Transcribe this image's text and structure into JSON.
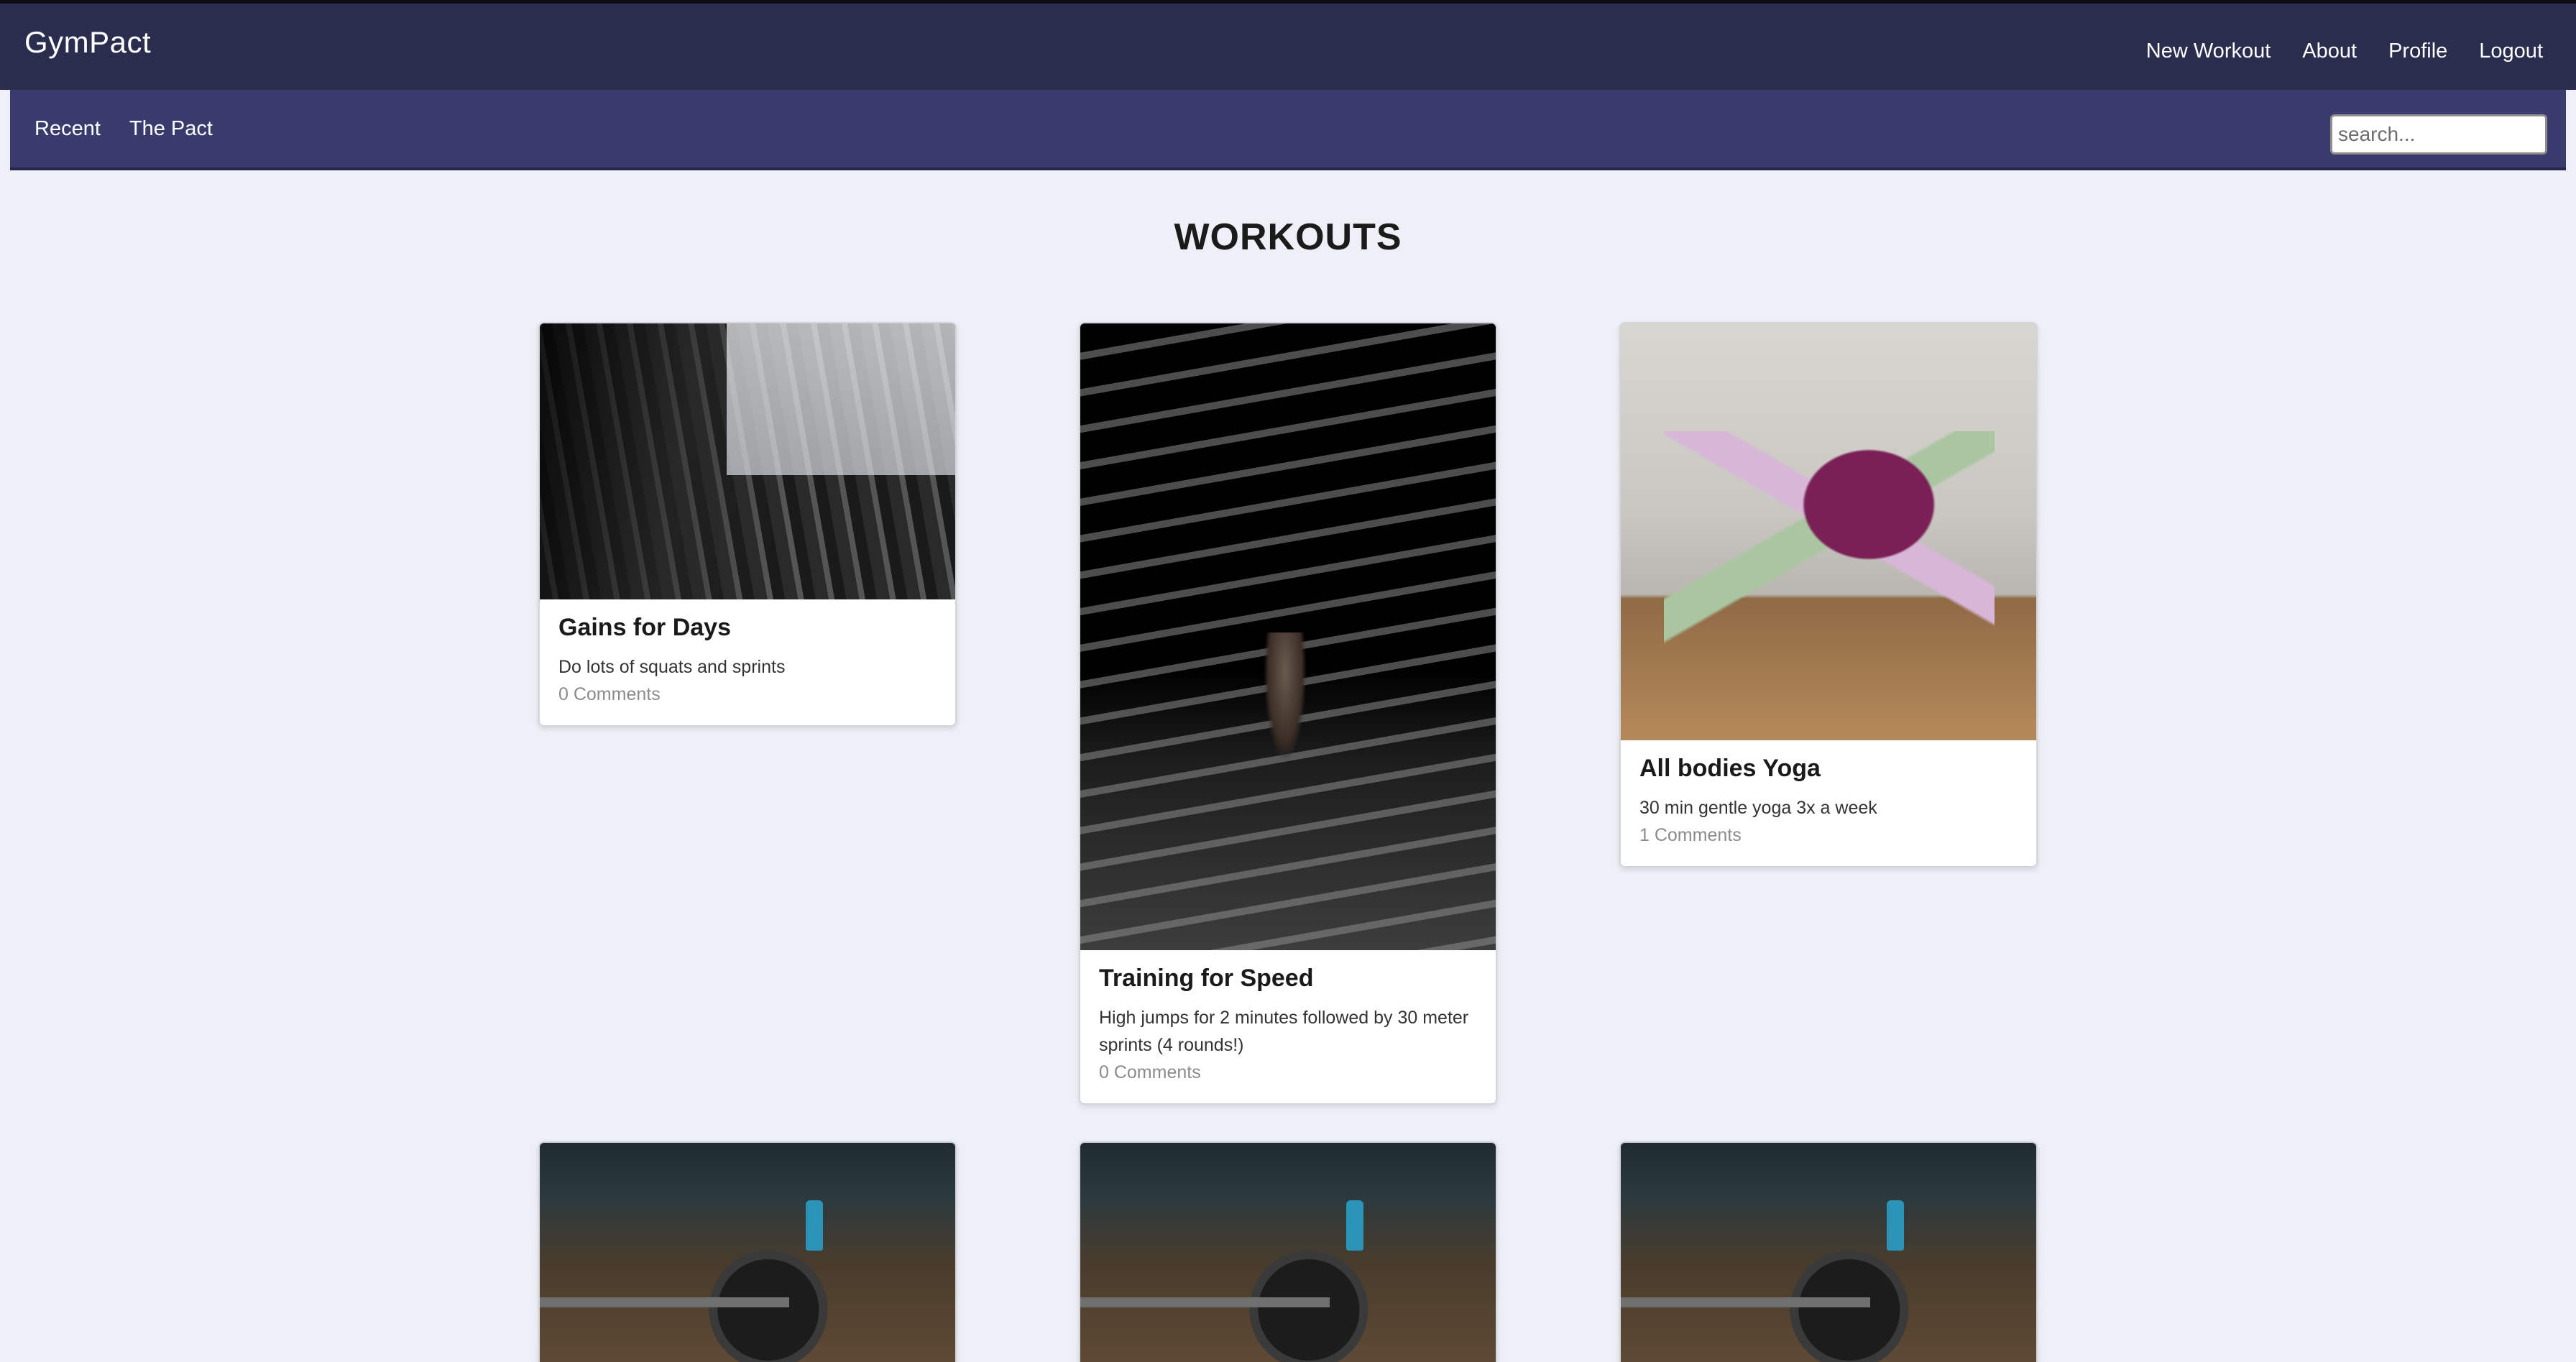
{
  "header": {
    "brand": "GymPact",
    "nav": [
      "New Workout",
      "About",
      "Profile",
      "Logout"
    ]
  },
  "subnav": {
    "links": [
      "Recent",
      "The Pact"
    ],
    "search_placeholder": "search..."
  },
  "main": {
    "title": "WORKOUTS",
    "cards": [
      {
        "title": "Gains for Days",
        "description": "Do lots of squats and sprints",
        "comments": "0 Comments",
        "image": "gym-dumbbell-rack-photo"
      },
      {
        "title": "Training for Speed",
        "description": "High jumps for 2 minutes followed by 30 meter sprints (4 rounds!)",
        "comments": "0 Comments",
        "image": "runner-on-dark-steps-photo"
      },
      {
        "title": "All bodies Yoga",
        "description": "30 min gentle yoga 3x a week",
        "comments": "1 Comments",
        "image": "yoga-pose-photo"
      },
      {
        "image": "barbell-gym-floor-photo"
      },
      {
        "image": "barbell-gym-floor-photo"
      },
      {
        "image": "barbell-gym-floor-photo"
      }
    ]
  },
  "colors": {
    "topbar": "#2a2d4e",
    "subnav": "#383b6c",
    "background": "#efeff8"
  }
}
